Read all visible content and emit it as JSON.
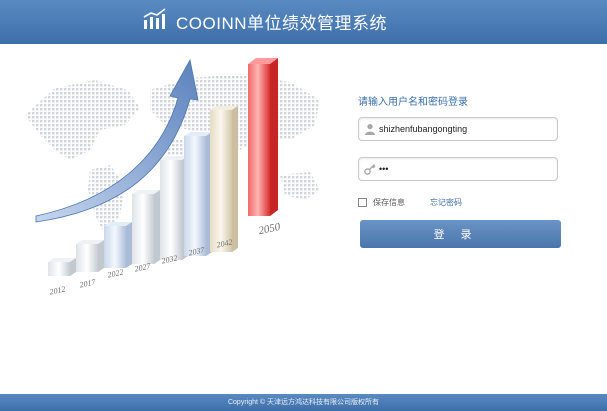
{
  "header": {
    "title": "COOINN单位绩效管理系统"
  },
  "hero": {
    "years": [
      "2012",
      "2017",
      "2022",
      "2027",
      "2032",
      "2037",
      "2042",
      "2050"
    ]
  },
  "login": {
    "prompt": "请输入用户名和密码登录",
    "username_value": "shizhenfubangongting",
    "password_value": "•••",
    "remember_label": "保存信息",
    "forgot_label": "忘记密码",
    "submit_label": "登录"
  },
  "footer": {
    "copyright": "Copyright © 天津远方鸿达科技有限公司版权所有"
  },
  "colors": {
    "accent": "#4a76ad",
    "highlight_bar": "#e8393a"
  }
}
